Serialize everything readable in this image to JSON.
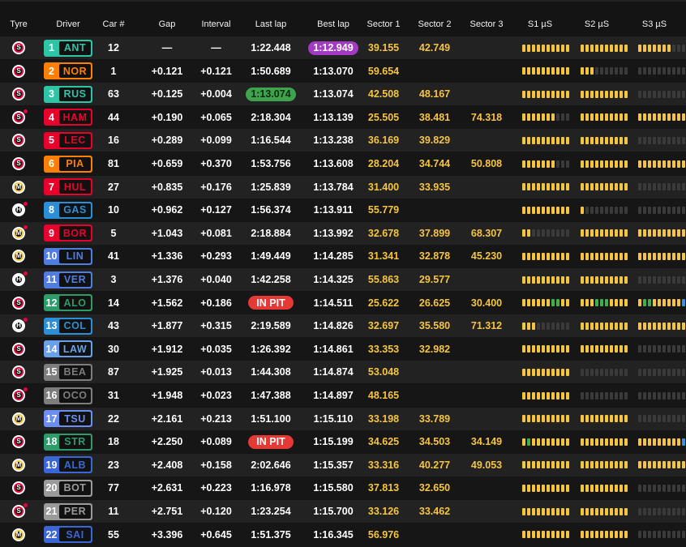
{
  "headers": {
    "tyre": "Tyre",
    "driver": "Driver",
    "car": "Car #",
    "gap": "Gap",
    "interval": "Interval",
    "last": "Last lap",
    "best": "Best lap",
    "s1": "Sector 1",
    "s2": "Sector 2",
    "s3": "Sector 3",
    "m1": "S1 µS",
    "m2": "S2 µS",
    "m3": "S3 µS"
  },
  "tyre_labels": {
    "S": "S",
    "M": "M",
    "H": "H"
  },
  "colors": {
    "soft": "#e8003a",
    "medium": "#f5c542",
    "hard": "#ffffff",
    "purple": "#a23ac4",
    "green": "#3fa34d",
    "pit": "#e53935"
  },
  "rows": [
    {
      "tyre": "S",
      "new": false,
      "pos": "1",
      "code": "ANT",
      "team": "#2ec4a6",
      "car": "12",
      "gap": "—",
      "interval": "—",
      "last": "1:22.448",
      "last_style": "",
      "best": "1:12.949",
      "best_style": "purple",
      "s1": "39.155",
      "s2": "42.749",
      "s3": "",
      "m1": "yyyyyyyyyy",
      "m2": "yyyyyyyyyy",
      "m3": "yyyyyyyddd"
    },
    {
      "tyre": "S",
      "new": false,
      "pos": "2",
      "code": "NOR",
      "team": "#ff8000",
      "car": "1",
      "gap": "+0.121",
      "interval": "+0.121",
      "last": "1:50.689",
      "last_style": "",
      "best": "1:13.070",
      "best_style": "",
      "s1": "59.654",
      "s2": "",
      "s3": "",
      "m1": "yyyyyyyyyy",
      "m2": "yyyddddddd",
      "m3": "dddddddddd"
    },
    {
      "tyre": "S",
      "new": false,
      "pos": "3",
      "code": "RUS",
      "team": "#2ec4a6",
      "car": "63",
      "gap": "+0.125",
      "interval": "+0.004",
      "last": "1:13.074",
      "last_style": "green",
      "best": "1:13.074",
      "best_style": "",
      "s1": "42.508",
      "s2": "48.167",
      "s3": "",
      "m1": "yyyyyyyyyy",
      "m2": "yyyyyyyyyy",
      "m3": "dddddddddd"
    },
    {
      "tyre": "S",
      "new": true,
      "pos": "4",
      "code": "HAM",
      "team": "#e8002d",
      "car": "44",
      "gap": "+0.190",
      "interval": "+0.065",
      "last": "2:18.304",
      "last_style": "",
      "best": "1:13.139",
      "best_style": "",
      "s1": "25.505",
      "s2": "38.481",
      "s3": "74.318",
      "m1": "yyyyyyyddd",
      "m2": "yyyyyyyyyy",
      "m3": "yyyyyyyyyy"
    },
    {
      "tyre": "S",
      "new": false,
      "pos": "5",
      "code": "LEC",
      "team": "#e8002d",
      "car": "16",
      "gap": "+0.289",
      "interval": "+0.099",
      "last": "1:16.544",
      "last_style": "",
      "best": "1:13.238",
      "best_style": "",
      "s1": "36.169",
      "s2": "39.829",
      "s3": "",
      "m1": "yyyyyyyyyy",
      "m2": "yyyyyyyyyy",
      "m3": "dddddddddd"
    },
    {
      "tyre": "S",
      "new": false,
      "pos": "6",
      "code": "PIA",
      "team": "#ff8000",
      "car": "81",
      "gap": "+0.659",
      "interval": "+0.370",
      "last": "1:53.756",
      "last_style": "",
      "best": "1:13.608",
      "best_style": "",
      "s1": "28.204",
      "s2": "34.744",
      "s3": "50.808",
      "m1": "yyyyyyyddd",
      "m2": "yyyyyyyyyy",
      "m3": "yyyyyyyyyy"
    },
    {
      "tyre": "M",
      "new": false,
      "pos": "7",
      "code": "HUL",
      "team": "#e8002d",
      "car": "27",
      "gap": "+0.835",
      "interval": "+0.176",
      "last": "1:25.839",
      "last_style": "",
      "best": "1:13.784",
      "best_style": "",
      "s1": "31.400",
      "s2": "33.935",
      "s3": "",
      "m1": "yyyyyyyyyy",
      "m2": "yyyyyyyyyy",
      "m3": "dddddddddd"
    },
    {
      "tyre": "H",
      "new": true,
      "pos": "8",
      "code": "GAS",
      "team": "#2c8fd6",
      "car": "10",
      "gap": "+0.962",
      "interval": "+0.127",
      "last": "1:56.374",
      "last_style": "",
      "best": "1:13.911",
      "best_style": "",
      "s1": "55.779",
      "s2": "",
      "s3": "",
      "m1": "yyyyyyyyyy",
      "m2": "yddddddddd",
      "m3": "dddddddddd"
    },
    {
      "tyre": "M",
      "new": true,
      "pos": "9",
      "code": "BOR",
      "team": "#e8002d",
      "car": "5",
      "gap": "+1.043",
      "interval": "+0.081",
      "last": "2:18.884",
      "last_style": "",
      "best": "1:13.992",
      "best_style": "",
      "s1": "32.678",
      "s2": "37.899",
      "s3": "68.307",
      "m1": "yyddddddddd",
      "m2": "yyyyyyyyyy",
      "m3": "yyyyyyyyyy"
    },
    {
      "tyre": "M",
      "new": false,
      "pos": "10",
      "code": "LIN",
      "team": "#4f7de0",
      "car": "41",
      "gap": "+1.336",
      "interval": "+0.293",
      "last": "1:49.449",
      "last_style": "",
      "best": "1:14.285",
      "best_style": "",
      "s1": "31.341",
      "s2": "32.878",
      "s3": "45.230",
      "m1": "yyyyyyyyyy",
      "m2": "yyyyyyyyyy",
      "m3": "yyyyyyyyyy"
    },
    {
      "tyre": "H",
      "new": true,
      "pos": "11",
      "code": "VER",
      "team": "#4f7de0",
      "car": "3",
      "gap": "+1.376",
      "interval": "+0.040",
      "last": "1:42.258",
      "last_style": "",
      "best": "1:14.325",
      "best_style": "",
      "s1": "55.863",
      "s2": "29.577",
      "s3": "",
      "m1": "yyyyyyyyyy",
      "m2": "yyyyyyyyyy",
      "m3": "dddddddddd"
    },
    {
      "tyre": "S",
      "new": false,
      "pos": "12",
      "code": "ALO",
      "team": "#2e9b6a",
      "car": "14",
      "gap": "+1.562",
      "interval": "+0.186",
      "last": "IN PIT",
      "last_style": "pit",
      "best": "1:14.511",
      "best_style": "",
      "s1": "25.622",
      "s2": "26.625",
      "s3": "30.400",
      "m1": "yyyyyyggyy",
      "m2": "yyygggyyyy",
      "m3": "yggyyyyyyb"
    },
    {
      "tyre": "H",
      "new": true,
      "pos": "13",
      "code": "COL",
      "team": "#2c8fd6",
      "car": "43",
      "gap": "+1.877",
      "interval": "+0.315",
      "last": "2:19.589",
      "last_style": "",
      "best": "1:14.826",
      "best_style": "",
      "s1": "32.697",
      "s2": "35.580",
      "s3": "71.312",
      "m1": "yyyddddddd",
      "m2": "yyyyyyyyyy",
      "m3": "yyyyyyyyyy"
    },
    {
      "tyre": "S",
      "new": false,
      "pos": "14",
      "code": "LAW",
      "team": "#6aa0ea",
      "car": "30",
      "gap": "+1.912",
      "interval": "+0.035",
      "last": "1:26.392",
      "last_style": "",
      "best": "1:14.861",
      "best_style": "",
      "s1": "33.353",
      "s2": "32.982",
      "s3": "",
      "m1": "yyyyyyyyyy",
      "m2": "yyyyyyyyyy",
      "m3": "dddddddddd"
    },
    {
      "tyre": "S",
      "new": false,
      "pos": "15",
      "code": "BEA",
      "team": "#7d7d7d",
      "car": "87",
      "gap": "+1.925",
      "interval": "+0.013",
      "last": "1:44.308",
      "last_style": "",
      "best": "1:14.874",
      "best_style": "",
      "s1": "53.048",
      "s2": "",
      "s3": "",
      "m1": "yyyyyyyyyy",
      "m2": "dddddddddd",
      "m3": "dddddddddd"
    },
    {
      "tyre": "S",
      "new": true,
      "pos": "16",
      "code": "OCO",
      "team": "#7d7d7d",
      "car": "31",
      "gap": "+1.948",
      "interval": "+0.023",
      "last": "1:47.388",
      "last_style": "",
      "best": "1:14.897",
      "best_style": "",
      "s1": "48.165",
      "s2": "",
      "s3": "",
      "m1": "yyyyyyyyyy",
      "m2": "dddddddddd",
      "m3": "dddddddddd"
    },
    {
      "tyre": "M",
      "new": false,
      "pos": "17",
      "code": "TSU",
      "team": "#6b8ff0",
      "car": "22",
      "gap": "+2.161",
      "interval": "+0.213",
      "last": "1:51.100",
      "last_style": "",
      "best": "1:15.110",
      "best_style": "",
      "s1": "33.198",
      "s2": "33.789",
      "s3": "",
      "m1": "yyyyyyyyyy",
      "m2": "yyyyyyyyyy",
      "m3": "dddddddddd"
    },
    {
      "tyre": "S",
      "new": false,
      "pos": "18",
      "code": "STR",
      "team": "#2e9b6a",
      "car": "18",
      "gap": "+2.250",
      "interval": "+0.089",
      "last": "IN PIT",
      "last_style": "pit",
      "best": "1:15.199",
      "best_style": "",
      "s1": "34.625",
      "s2": "34.503",
      "s3": "34.149",
      "m1": "ygyyyyyyyy",
      "m2": "yyyyyyyyyy",
      "m3": "yyyyyyyyyb"
    },
    {
      "tyre": "M",
      "new": false,
      "pos": "19",
      "code": "ALB",
      "team": "#3a66d6",
      "car": "23",
      "gap": "+2.408",
      "interval": "+0.158",
      "last": "2:02.646",
      "last_style": "",
      "best": "1:15.357",
      "best_style": "",
      "s1": "33.316",
      "s2": "40.277",
      "s3": "49.053",
      "m1": "yyyyyyyyyy",
      "m2": "yyyyyyyyyy",
      "m3": "yyyyyyyyyy"
    },
    {
      "tyre": "S",
      "new": false,
      "pos": "20",
      "code": "BOT",
      "team": "#9a9a9a",
      "car": "77",
      "gap": "+2.631",
      "interval": "+0.223",
      "last": "1:16.978",
      "last_style": "",
      "best": "1:15.580",
      "best_style": "",
      "s1": "37.813",
      "s2": "32.650",
      "s3": "",
      "m1": "yyyyyyyyyy",
      "m2": "yyyyyyyyyy",
      "m3": "dddddddddd"
    },
    {
      "tyre": "S",
      "new": true,
      "pos": "21",
      "code": "PER",
      "team": "#9a9a9a",
      "car": "11",
      "gap": "+2.751",
      "interval": "+0.120",
      "last": "1:23.254",
      "last_style": "",
      "best": "1:15.700",
      "best_style": "",
      "s1": "33.126",
      "s2": "33.462",
      "s3": "",
      "m1": "yyyyyyyyyy",
      "m2": "yyyyyyyyyy",
      "m3": "dddddddddd"
    },
    {
      "tyre": "M",
      "new": false,
      "pos": "22",
      "code": "SAI",
      "team": "#3a66d6",
      "car": "55",
      "gap": "+3.396",
      "interval": "+0.645",
      "last": "1:51.375",
      "last_style": "",
      "best": "1:16.345",
      "best_style": "",
      "s1": "56.976",
      "s2": "",
      "s3": "",
      "m1": "yyyyyyyyyy",
      "m2": "yyyyyyyyyy",
      "m3": "dddddddddd"
    }
  ]
}
